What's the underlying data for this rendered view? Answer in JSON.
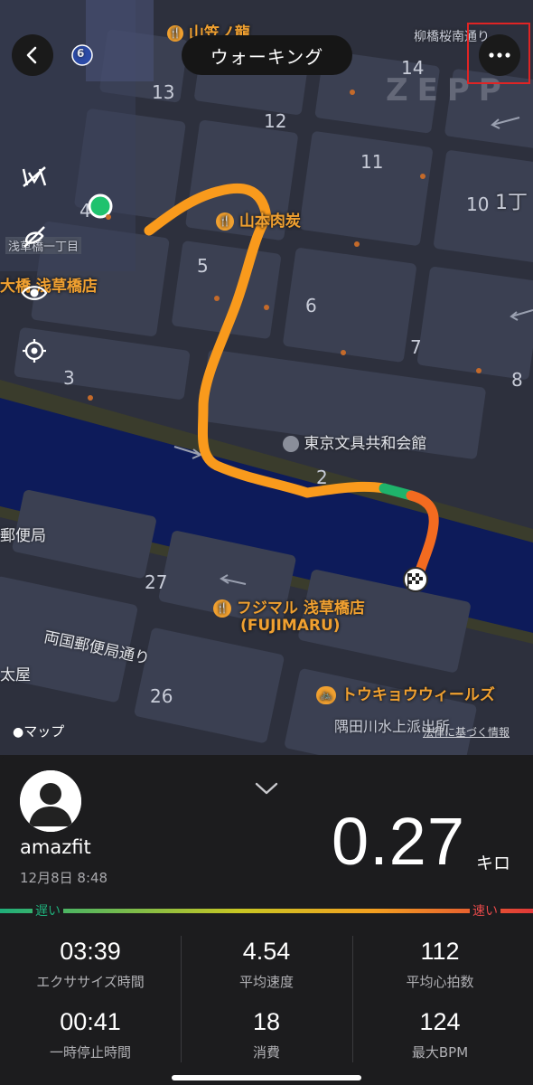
{
  "header": {
    "title": "ウォーキング",
    "back_icon": "chevron-left-icon",
    "more_icon": "ellipsis-icon"
  },
  "map": {
    "block_numbers": [
      "13",
      "12",
      "11",
      "14",
      "10",
      "4",
      "5",
      "6",
      "7",
      "8",
      "3",
      "2",
      "27",
      "26"
    ],
    "pois": {
      "restaurant_top": "山笠ノ龍",
      "yakiniku": "山本肉炭",
      "asakusabashi_store": "大橋 浅草橋店",
      "area_label": "浅草橋一丁目",
      "yanagibashi": "柳橋桜南通り",
      "itchome": "1丁",
      "stationery": "東京文具共和会館",
      "post_office": "郵便局",
      "ryogoku_street": "両国郵便局通り",
      "fujimaru": "フジマル 浅草橋店",
      "fujimaru_en": "(FUJIMARU)",
      "tokyo_wheels": "トウキョウウィールズ",
      "sumida_station": "隅田川水上派出所",
      "taiya": "太屋",
      "zepp": "ZEPP"
    },
    "route_badge": "6",
    "apple_maps_label": "マップ",
    "legal_text": "法律に基づく情報",
    "side_icons": [
      "map-style-off-icon",
      "hide-route-icon",
      "eye-icon",
      "locate-icon"
    ]
  },
  "summary": {
    "username": "amazfit",
    "datetime": "12月8日 8:48",
    "distance": "0.27",
    "distance_unit": "キロ",
    "slow_label": "遅い",
    "fast_label": "速い",
    "speed_colors": {
      "slow": "#1fae7a",
      "mid": "#f3c623",
      "fast": "#e03838"
    }
  },
  "stats": [
    {
      "value": "03:39",
      "label": "エクササイズ時間"
    },
    {
      "value": "4.54",
      "label": "平均速度"
    },
    {
      "value": "112",
      "label": "平均心拍数"
    },
    {
      "value": "00:41",
      "label": "一時停止時間"
    },
    {
      "value": "18",
      "label": "消費"
    },
    {
      "value": "124",
      "label": "最大BPM"
    }
  ]
}
